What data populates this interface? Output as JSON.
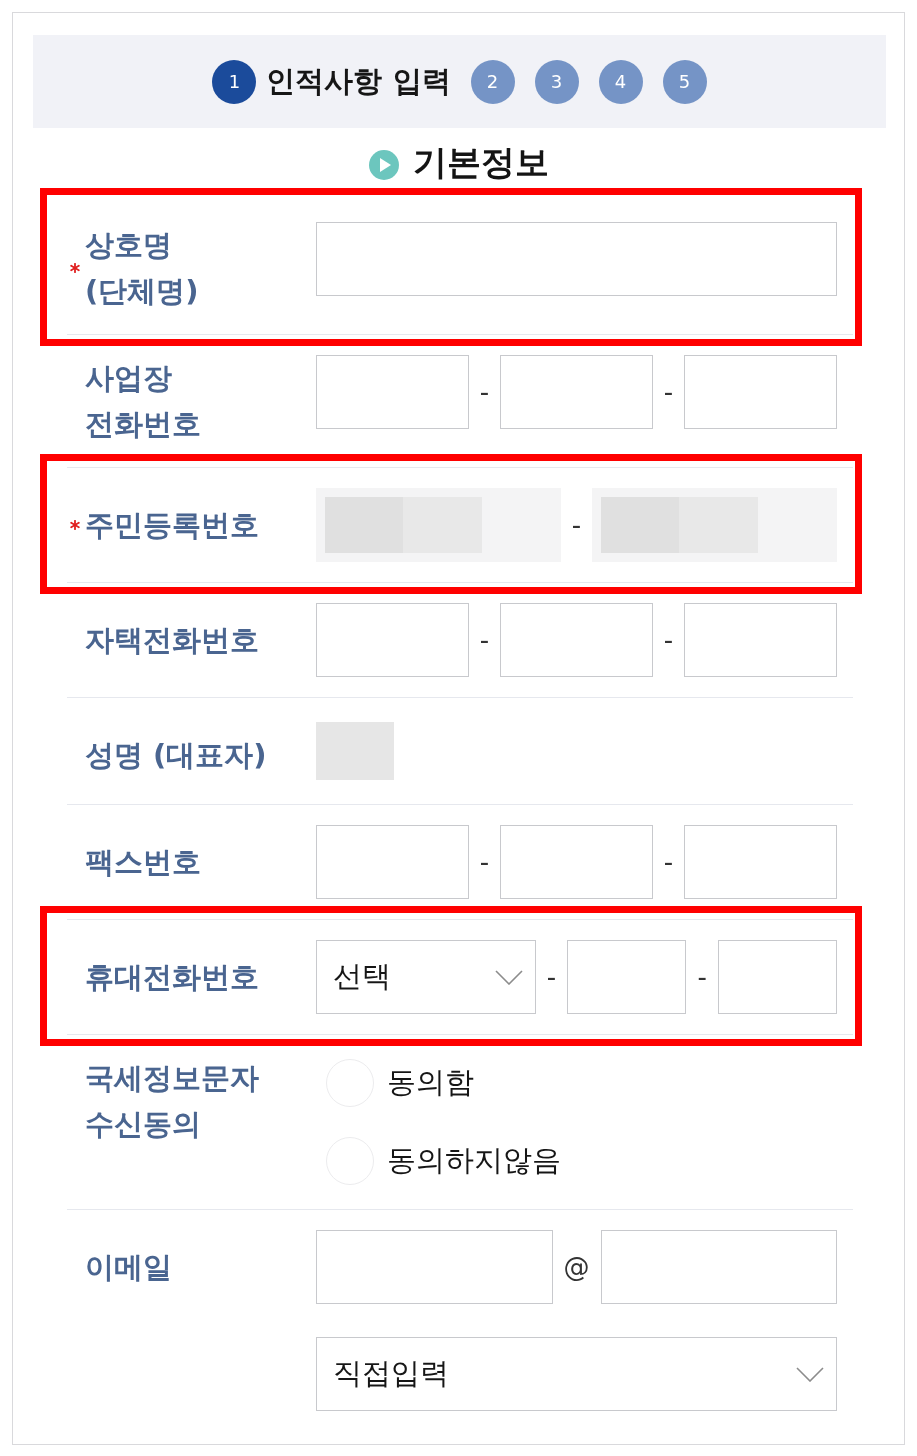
{
  "stepper": {
    "steps": [
      {
        "number": "1",
        "label": "인적사항 입력",
        "selected": true
      },
      {
        "number": "2",
        "selected": false
      },
      {
        "number": "3",
        "selected": false
      },
      {
        "number": "4",
        "selected": false
      },
      {
        "number": "5",
        "selected": false
      }
    ]
  },
  "section": {
    "title": "기본정보"
  },
  "form": {
    "rows": [
      {
        "label_lines": [
          "상호명",
          "(단체명)"
        ],
        "required": true,
        "highlighted": true,
        "lines": [
          [
            {
              "kind": "input"
            }
          ]
        ]
      },
      {
        "label_lines": [
          "사업장",
          "전화번호"
        ],
        "required": false,
        "highlighted": false,
        "lines": [
          [
            {
              "kind": "input"
            },
            {
              "kind": "separator",
              "text": "-"
            },
            {
              "kind": "input"
            },
            {
              "kind": "separator",
              "text": "-"
            },
            {
              "kind": "input"
            }
          ]
        ]
      },
      {
        "label_lines": [
          "주민등록번호"
        ],
        "required": true,
        "highlighted": true,
        "lines": [
          [
            {
              "kind": "masked"
            },
            {
              "kind": "separator",
              "text": "-"
            },
            {
              "kind": "masked"
            }
          ]
        ]
      },
      {
        "label_lines": [
          "자택전화번호"
        ],
        "required": false,
        "highlighted": false,
        "lines": [
          [
            {
              "kind": "input"
            },
            {
              "kind": "separator",
              "text": "-"
            },
            {
              "kind": "input"
            },
            {
              "kind": "separator",
              "text": "-"
            },
            {
              "kind": "input"
            }
          ]
        ]
      },
      {
        "label_lines": [
          "성명 (대표자)"
        ],
        "required": false,
        "highlighted": false,
        "lines": [
          [
            {
              "kind": "redacted"
            }
          ]
        ]
      },
      {
        "label_lines": [
          "팩스번호"
        ],
        "required": false,
        "highlighted": false,
        "lines": [
          [
            {
              "kind": "input"
            },
            {
              "kind": "separator",
              "text": "-"
            },
            {
              "kind": "input"
            },
            {
              "kind": "separator",
              "text": "-"
            },
            {
              "kind": "input"
            }
          ]
        ]
      },
      {
        "label_lines": [
          "휴대전화번호"
        ],
        "required": false,
        "highlighted": true,
        "lines": [
          [
            {
              "kind": "select",
              "value": "선택"
            },
            {
              "kind": "separator",
              "text": "-"
            },
            {
              "kind": "input"
            },
            {
              "kind": "separator",
              "text": "-"
            },
            {
              "kind": "input"
            }
          ]
        ]
      },
      {
        "label_lines": [
          "국세정보문자",
          "수신동의"
        ],
        "required": false,
        "highlighted": false,
        "lines": [
          [
            {
              "kind": "radio",
              "label": "동의함",
              "selected": false
            }
          ],
          [
            {
              "kind": "radio",
              "label": "동의하지않음",
              "selected": false
            }
          ]
        ]
      },
      {
        "label_lines": [
          "이메일"
        ],
        "required": false,
        "highlighted": false,
        "lines": [
          [
            {
              "kind": "input"
            },
            {
              "kind": "separator",
              "text": "@"
            },
            {
              "kind": "input"
            }
          ],
          [
            {
              "kind": "select",
              "value": "직접입력"
            }
          ]
        ]
      }
    ]
  }
}
